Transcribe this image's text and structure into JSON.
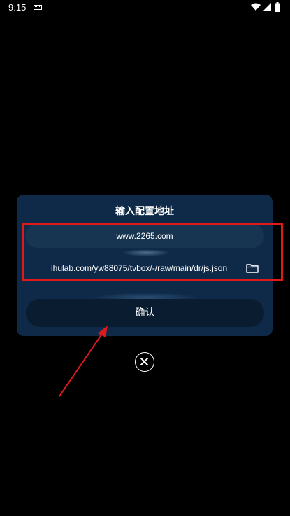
{
  "status_bar": {
    "time": "9:15",
    "icons": [
      "keyboard-icon",
      "wifi-icon",
      "signal-icon",
      "battery-icon"
    ]
  },
  "dialog": {
    "title": "输入配置地址",
    "url_input_value": "www.2265.com",
    "config_input_value": "ihulab.com/yw88075/tvbox/-/raw/main/dr/js.json",
    "confirm_label": "确认",
    "folder_icon": "folder-icon"
  },
  "close_icon": "close-icon",
  "colors": {
    "background": "#000000",
    "dialog_bg": "#0e2a48",
    "input_bg": "#173450",
    "button_bg": "#0a1c30",
    "annotation": "#e01a1a",
    "text": "#ffffff"
  }
}
